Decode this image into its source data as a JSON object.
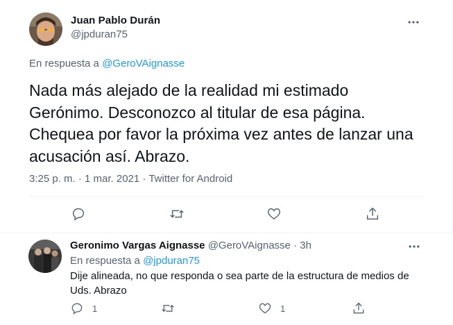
{
  "main_tweet": {
    "author_name": "Juan Pablo Durán",
    "author_handle": "@jpduran75",
    "reply_prefix": "En respuesta a",
    "reply_to": "@GeroVAignasse",
    "text": "Nada más alejado de la realidad mi estimado Gerónimo. Desconozco al titular de esa página. Chequea por favor la próxima vez antes de lanzar una acusación así. Abrazo.",
    "time": "3:25 p. m.",
    "date": "1 mar. 2021",
    "source": "Twitter for Android",
    "separator": "·"
  },
  "reply_tweet": {
    "author_name": "Geronimo Vargas Aignasse",
    "author_handle": "@GeroVAignasse",
    "separator": "·",
    "age": "3h",
    "reply_prefix": "En respuesta a",
    "reply_to": "@jpduran75",
    "text": "Dije alineada, no que responda o sea parte de la estructura de medios de Uds. Abrazo",
    "reply_count": "1",
    "like_count": "1"
  },
  "icons": [
    "more-icon",
    "reply-icon",
    "retweet-icon",
    "like-icon",
    "share-icon"
  ],
  "colors": {
    "link": "#1d9bf0",
    "secondary_text": "#536471",
    "primary_text": "#0f1419",
    "border": "#eff3f4"
  }
}
